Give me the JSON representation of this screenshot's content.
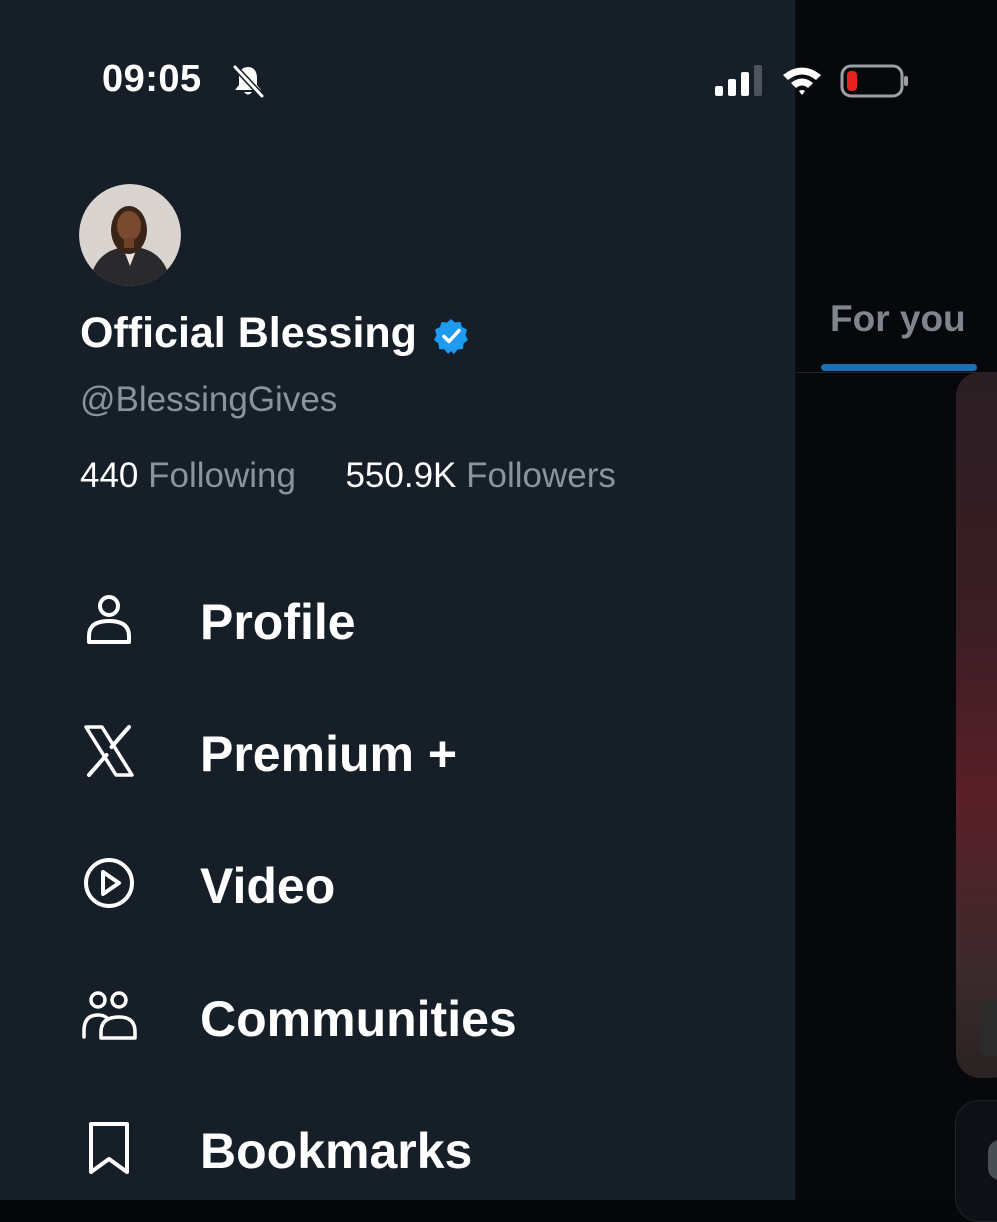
{
  "status_bar": {
    "time": "09:05",
    "icons": [
      "bell-slash-icon",
      "cellular-signal-icon",
      "wifi-icon",
      "battery-low-icon"
    ],
    "battery_color": "#e5231f"
  },
  "profile": {
    "display_name": "Official Blessing",
    "handle": "@BlessingGives",
    "verified_color": "#1d9bf0",
    "following_count": "440",
    "following_label": "Following",
    "followers_count": "550.9K",
    "followers_label": "Followers"
  },
  "menu": {
    "items": [
      {
        "label": "Profile",
        "icon": "person-icon"
      },
      {
        "label": "Premium +",
        "icon": "x-logo-icon"
      },
      {
        "label": "Video",
        "icon": "play-circle-icon"
      },
      {
        "label": "Communities",
        "icon": "people-icon"
      },
      {
        "label": "Bookmarks",
        "icon": "bookmark-icon"
      }
    ]
  },
  "background_feed": {
    "tab_label": "For you",
    "accent_color": "#1d6fb2"
  }
}
